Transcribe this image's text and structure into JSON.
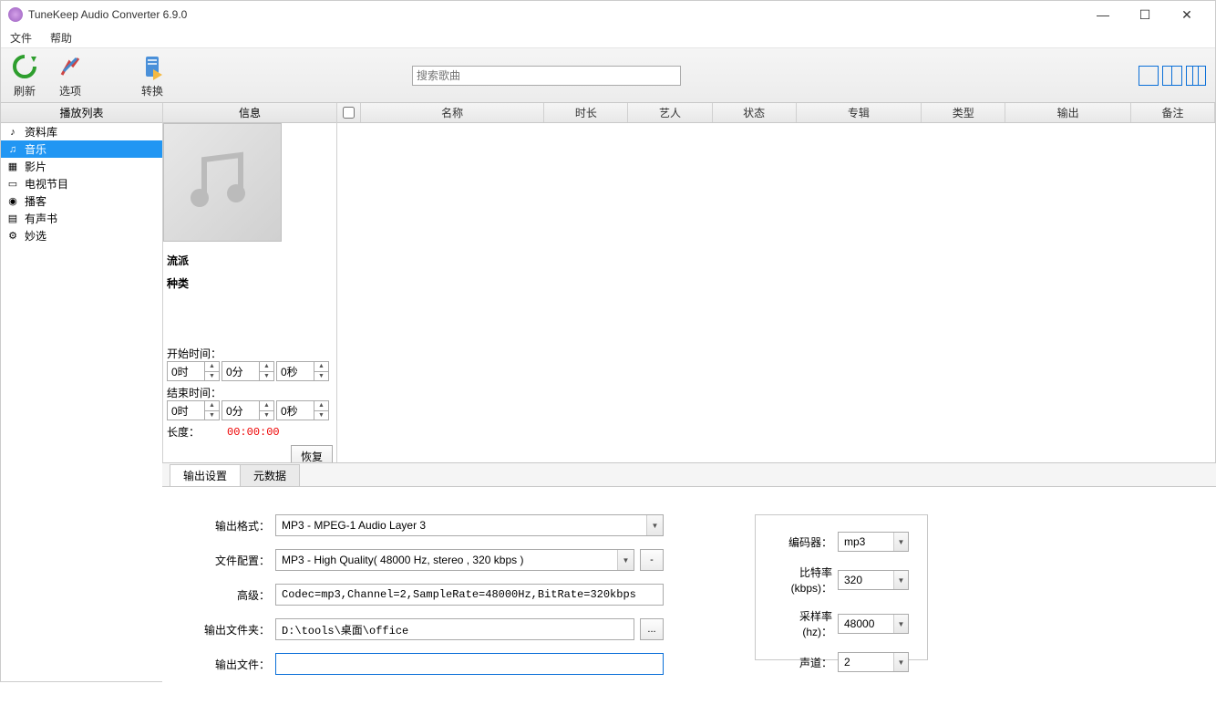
{
  "window": {
    "title": "TuneKeep Audio Converter 6.9.0"
  },
  "menu": {
    "file": "文件",
    "help": "帮助"
  },
  "toolbar": {
    "refresh": "刷新",
    "options": "选项",
    "convert": "转换",
    "search_placeholder": "搜索歌曲"
  },
  "sidebar": {
    "header": "播放列表",
    "items": [
      {
        "label": "资料库",
        "icon": "library"
      },
      {
        "label": "音乐",
        "icon": "music"
      },
      {
        "label": "影片",
        "icon": "movie"
      },
      {
        "label": "电视节目",
        "icon": "tv"
      },
      {
        "label": "播客",
        "icon": "podcast"
      },
      {
        "label": "有声书",
        "icon": "audiobook"
      },
      {
        "label": "妙选",
        "icon": "gear"
      }
    ]
  },
  "info": {
    "header": "信息",
    "genre": "流派",
    "kind": "种类",
    "start_label": "开始时间：",
    "end_label": "结束时间：",
    "hour0": "0时",
    "min0": "0分",
    "sec0": "0秒",
    "length_label": "长度：",
    "length_value": "00:00:00",
    "restore": "恢复"
  },
  "tracklist": {
    "cols": {
      "name": "名称",
      "duration": "时长",
      "artist": "艺人",
      "status": "状态",
      "album": "专辑",
      "type": "类型",
      "output": "输出",
      "remark": "备注"
    }
  },
  "tabs": {
    "output": "输出设置",
    "metadata": "元数据"
  },
  "settings": {
    "format_label": "输出格式：",
    "format_value": "MP3 - MPEG-1 Audio Layer 3",
    "profile_label": "文件配置：",
    "profile_value": "MP3 - High Quality( 48000 Hz, stereo , 320 kbps  )",
    "profile_minus": "-",
    "advanced_label": "高级：",
    "advanced_value": "Codec=mp3,Channel=2,SampleRate=48000Hz,BitRate=320kbps",
    "outfolder_label": "输出文件夹：",
    "outfolder_value": "D:\\tools\\桌面\\office",
    "browse": "...",
    "outfile_label": "输出文件：",
    "outfile_value": ""
  },
  "encoder": {
    "codec_label": "编码器：",
    "codec_value": "mp3",
    "bitrate_label": "比特率(kbps)：",
    "bitrate_value": "320",
    "sample_label": "采样率(hz)：",
    "sample_value": "48000",
    "channel_label": "声道：",
    "channel_value": "2"
  }
}
